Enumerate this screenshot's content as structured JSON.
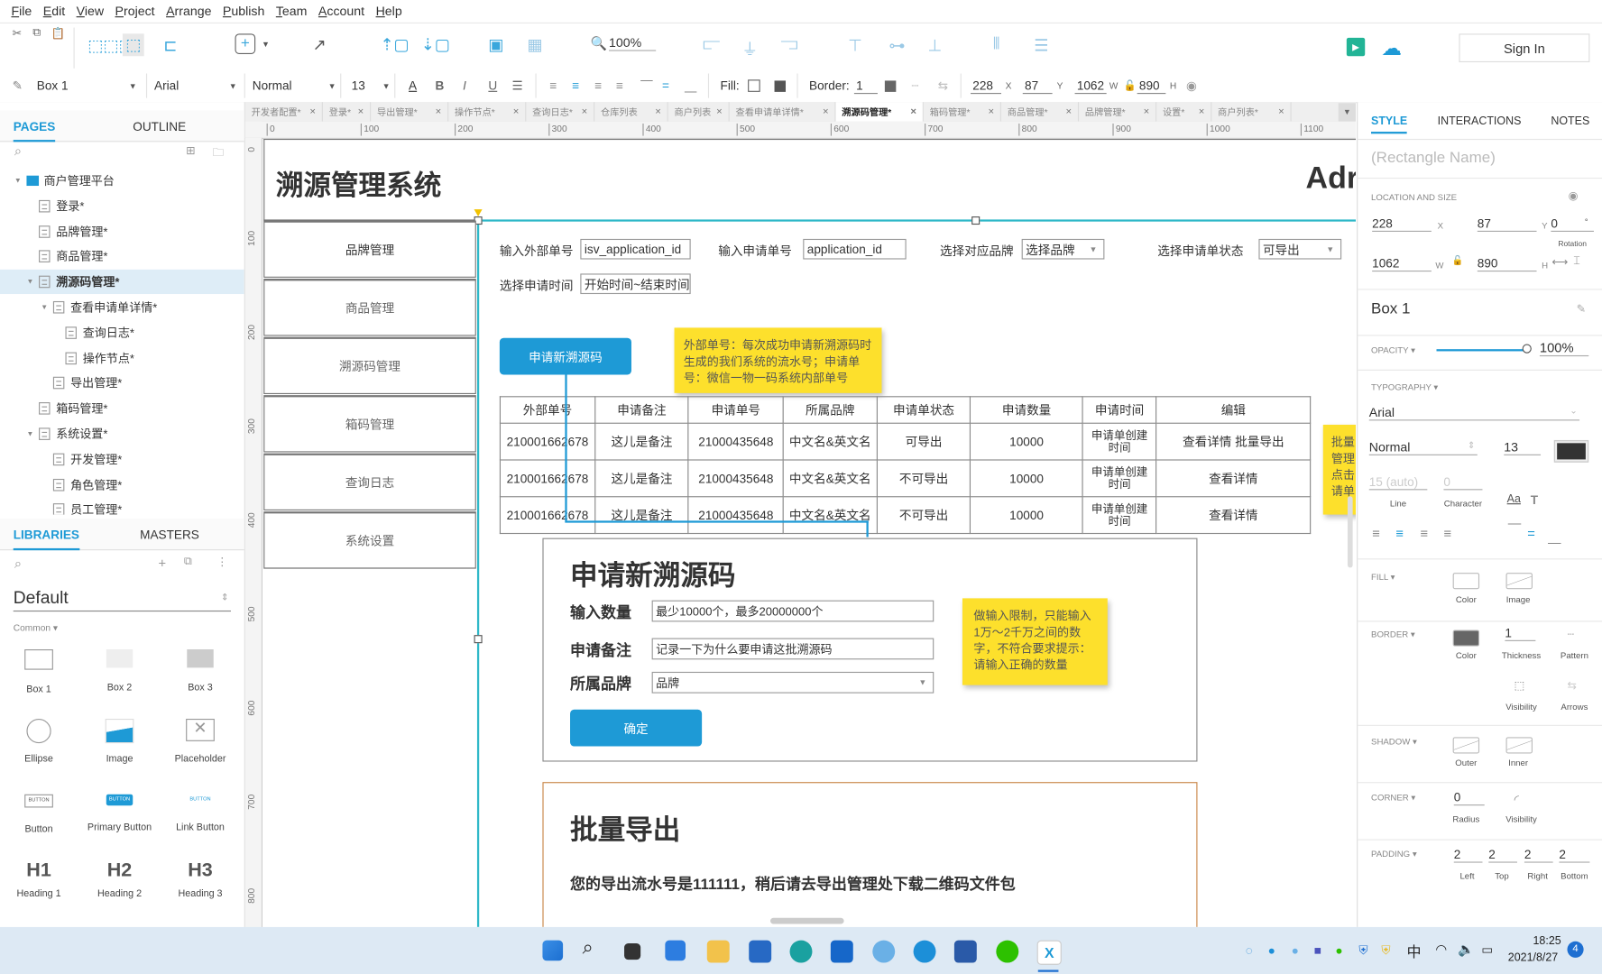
{
  "menu": [
    "File",
    "Edit",
    "View",
    "Project",
    "Arrange",
    "Publish",
    "Team",
    "Account",
    "Help"
  ],
  "toolbar": {
    "zoom_level": "100%",
    "sign_in": "Sign In"
  },
  "formatbar": {
    "widget_name": "Box 1",
    "font_family": "Arial",
    "font_style": "Normal",
    "font_size": "13",
    "fill_label": "Fill:",
    "border_label": "Border:",
    "border_value": "1",
    "x": "228",
    "x_label": "X",
    "y": "87",
    "y_label": "Y",
    "w": "1062",
    "w_label": "W",
    "h": "890",
    "h_label": "H"
  },
  "left_panel": {
    "tabs": [
      "PAGES",
      "OUTLINE"
    ],
    "tree": [
      {
        "label": "商户管理平台",
        "type": "folder"
      },
      {
        "label": "登录*",
        "type": "page"
      },
      {
        "label": "品牌管理*",
        "type": "page"
      },
      {
        "label": "商品管理*",
        "type": "page"
      },
      {
        "label": "溯源码管理*",
        "type": "page",
        "selected": true
      },
      {
        "label": "查看申请单详情*",
        "type": "page"
      },
      {
        "label": "查询日志*",
        "type": "page"
      },
      {
        "label": "操作节点*",
        "type": "page"
      },
      {
        "label": "导出管理*",
        "type": "page"
      },
      {
        "label": "箱码管理*",
        "type": "page"
      },
      {
        "label": "系统设置*",
        "type": "page"
      },
      {
        "label": "开发管理*",
        "type": "page"
      },
      {
        "label": "角色管理*",
        "type": "page"
      },
      {
        "label": "员工管理*",
        "type": "page"
      }
    ],
    "lib_tabs": [
      "LIBRARIES",
      "MASTERS"
    ],
    "library_name": "Default",
    "category": "Common ▾",
    "widgets": [
      "Box 1",
      "Box 2",
      "Box 3",
      "Ellipse",
      "Image",
      "Placeholder",
      "Button",
      "Primary Button",
      "Link Button",
      "Heading 1",
      "Heading 2",
      "Heading 3"
    ],
    "widget_glyphs": {
      "h1": "H1",
      "h2": "H2",
      "h3": "H3",
      "button": "BUTTON"
    }
  },
  "doc_tabs": [
    {
      "label": "开发者配置*"
    },
    {
      "label": "登录*"
    },
    {
      "label": "导出管理*"
    },
    {
      "label": "操作节点*"
    },
    {
      "label": "查询日志*"
    },
    {
      "label": "仓库列表"
    },
    {
      "label": "商户列表"
    },
    {
      "label": "查看申请单详情*"
    },
    {
      "label": "溯源码管理*",
      "active": true
    },
    {
      "label": "箱码管理*"
    },
    {
      "label": "商品管理*"
    },
    {
      "label": "品牌管理*"
    },
    {
      "label": "设置*"
    },
    {
      "label": "商户列表*"
    }
  ],
  "ruler": {
    "h": [
      "0",
      "100",
      "200",
      "300",
      "400",
      "500",
      "600",
      "700",
      "800",
      "900",
      "1000",
      "1100"
    ],
    "v": [
      "0",
      "100",
      "200",
      "300",
      "400",
      "500",
      "600",
      "700",
      "800"
    ]
  },
  "canvas": {
    "title": "溯源管理系统",
    "title_right": "Adr",
    "nav": [
      "品牌管理",
      "商品管理",
      "溯源码管理",
      "箱码管理",
      "查询日志",
      "系统设置"
    ],
    "filters": {
      "ext_no_label": "输入外部单号",
      "ext_no_value": "isv_application_id",
      "app_no_label": "输入申请单号",
      "app_no_value": "application_id",
      "brand_label": "选择对应品牌",
      "brand_value": "选择品牌",
      "status_label": "选择申请单状态",
      "status_value": "可导出",
      "time_label": "选择申请时间",
      "time_value": "开始时间~结束时间"
    },
    "apply_button": "申请新溯源码",
    "note1": "外部单号：每次成功申请新溯源码时生成的我们系统的流水号；申请单号：微信一物一码系统内部单号",
    "note_side": "批量管理点击请单",
    "table": {
      "headers": [
        "外部单号",
        "申请备注",
        "申请单号",
        "所属品牌",
        "申请单状态",
        "申请数量",
        "申请时间",
        "编辑"
      ],
      "rows": [
        [
          "210001662678",
          "这儿是备注",
          "21000435648",
          "中文名&英文名",
          "可导出",
          "10000",
          "申请单创建时间",
          "查看详情  批量导出"
        ],
        [
          "210001662678",
          "这儿是备注",
          "21000435648",
          "中文名&英文名",
          "不可导出",
          "10000",
          "申请单创建时间",
          "查看详情"
        ],
        [
          "210001662678",
          "这儿是备注",
          "21000435648",
          "中文名&英文名",
          "不可导出",
          "10000",
          "申请单创建时间",
          "查看详情"
        ]
      ]
    },
    "dialog": {
      "title": "申请新溯源码",
      "qty_label": "输入数量",
      "qty_value": "最少10000个，最多20000000个",
      "remark_label": "申请备注",
      "remark_value": "记录一下为什么要申请这批溯源码",
      "brand_label": "所属品牌",
      "brand_value": "品牌",
      "confirm": "确定"
    },
    "note2": "做输入限制，只能输入1万～2千万之间的数字，不符合要求提示：请输入正确的数量",
    "export": {
      "title": "批量导出",
      "message": "您的导出流水号是111111，稍后请去导出管理处下载二维码文件包"
    }
  },
  "right_panel": {
    "tabs": [
      "STYLE",
      "INTERACTIONS",
      "NOTES"
    ],
    "name_placeholder": "(Rectangle Name)",
    "location_label": "LOCATION AND SIZE",
    "x": "228",
    "y": "87",
    "rotation": "0",
    "rotation_label": "Rotation",
    "w": "1062",
    "h": "890",
    "x_label": "X",
    "y_label": "Y",
    "w_label": "W",
    "h_label": "H",
    "deg": "°",
    "style_name": "Box 1",
    "opacity_label": "OPACITY ▾",
    "opacity": "100%",
    "opacity_fraction": 1.0,
    "typography_label": "TYPOGRAPHY ▾",
    "font": "Arial",
    "font_style": "Normal",
    "font_size": "13",
    "line": "15 (auto)",
    "line_label": "Line",
    "character": "0",
    "character_label": "Character",
    "fill_label": "FILL ▾",
    "fill_color": "Color",
    "fill_image": "Image",
    "border_label": "BORDER ▾",
    "border_color": "Color",
    "thickness": "1",
    "thickness_label": "Thickness",
    "pattern": "Pattern",
    "visibility": "Visibility",
    "arrows": "Arrows",
    "shadow_label": "SHADOW ▾",
    "outer": "Outer",
    "inner": "Inner",
    "corner_label": "CORNER ▾",
    "radius": "0",
    "radius_label": "Radius",
    "corner_visibility": "Visibility",
    "padding_label": "PADDING ▾",
    "padding": [
      "2",
      "2",
      "2",
      "2"
    ],
    "padding_labels": [
      "Left",
      "Top",
      "Right",
      "Bottom"
    ]
  },
  "taskbar": {
    "ime": "中",
    "time": "18:25",
    "date": "2021/8/27",
    "notifications": "4"
  },
  "colors": {
    "accent": "#1e9ad6",
    "sticky": "#fde02c",
    "selection": "#2fb8c8"
  }
}
